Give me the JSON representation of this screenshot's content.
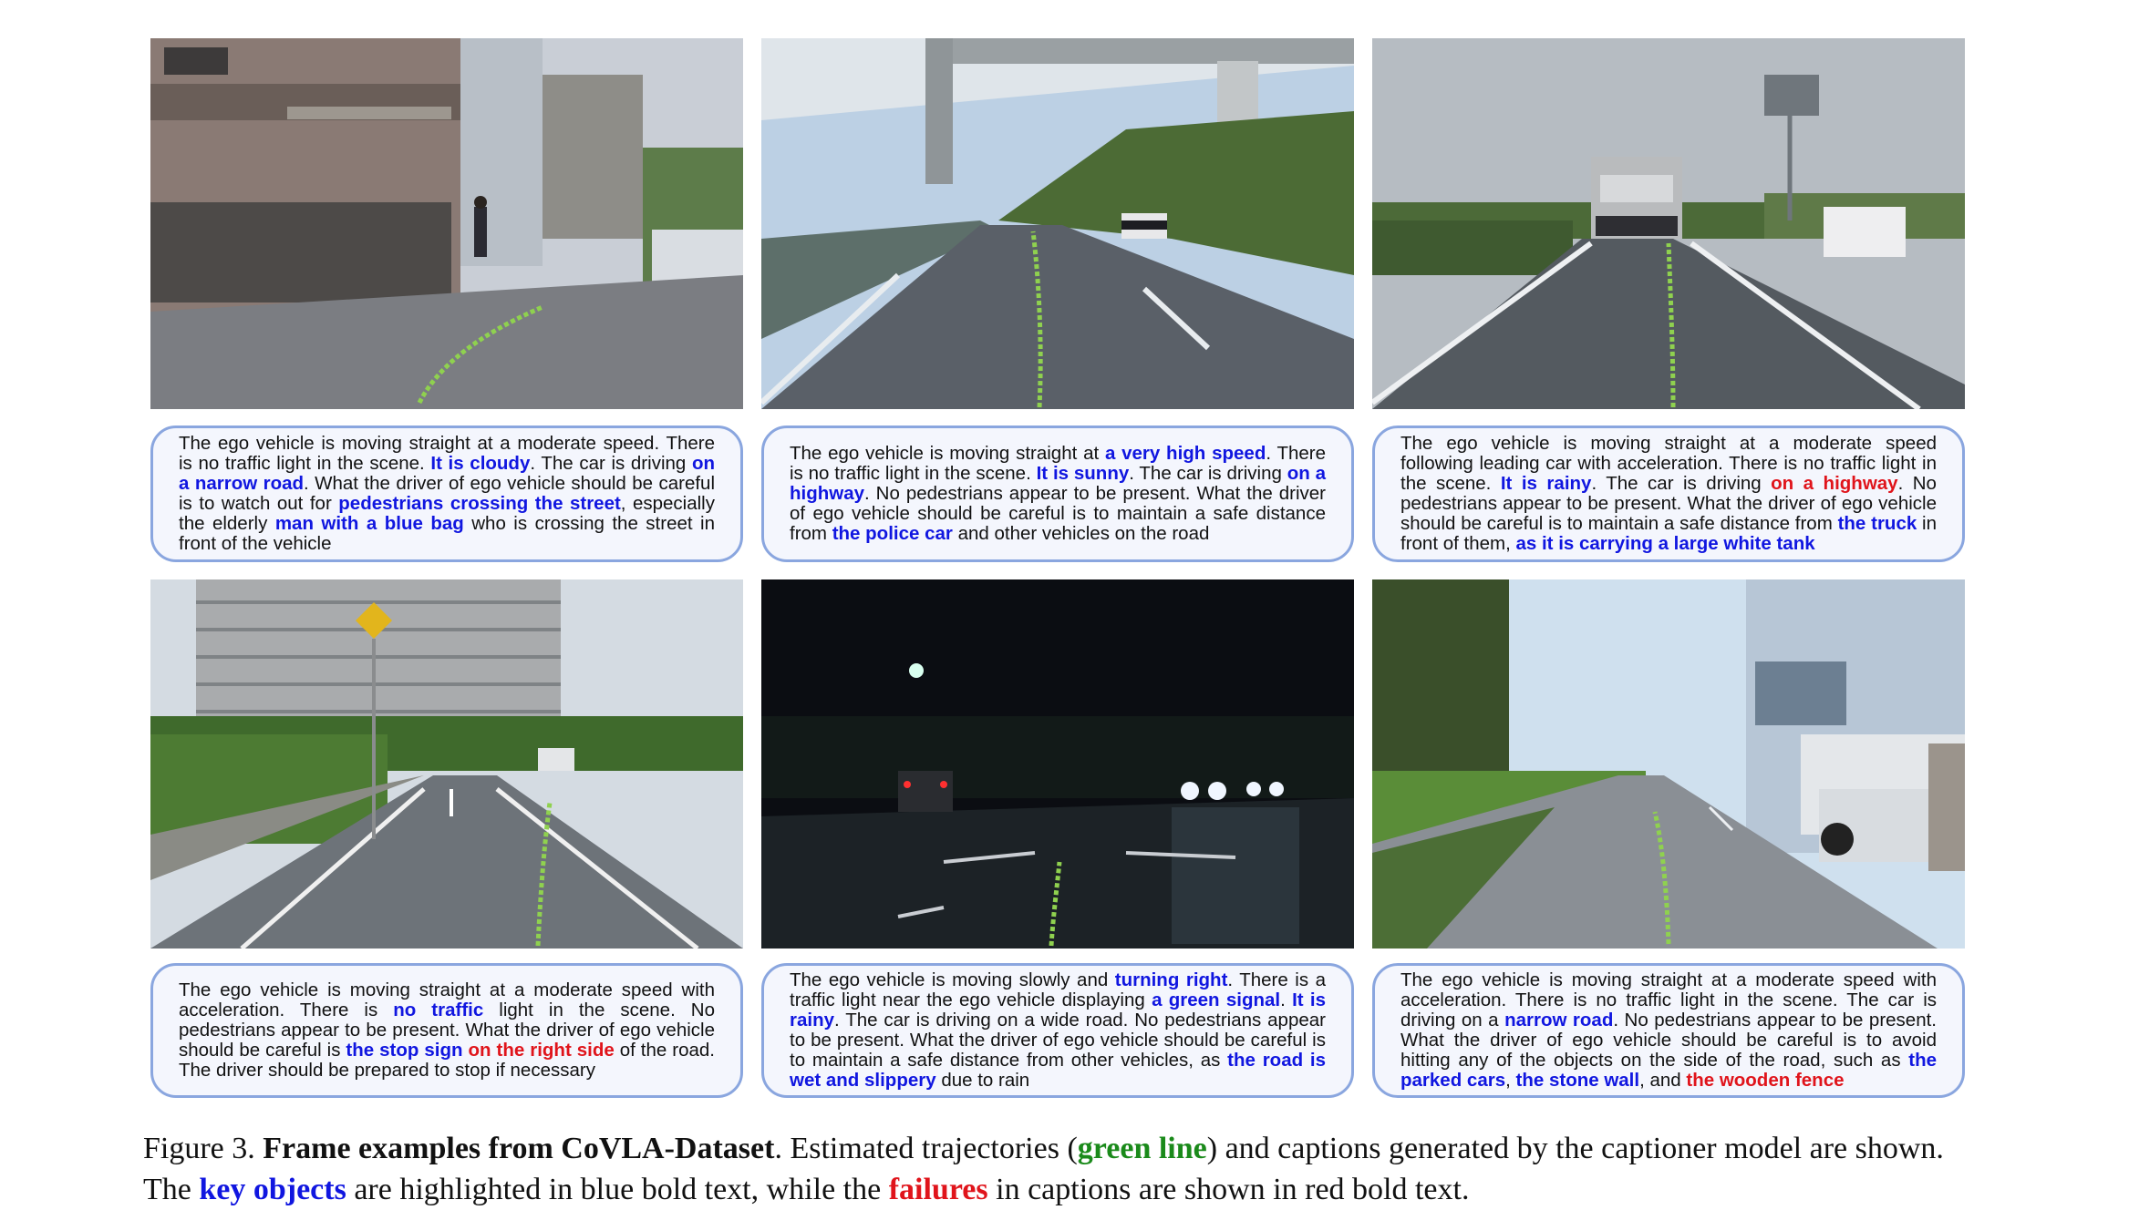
{
  "colors": {
    "key_object": "#1016e0",
    "failure": "#e0141b",
    "trajectory": "#8fd14f",
    "caption_border": "#8aa6df"
  },
  "frames": [
    {
      "scene": "narrow residential street with pedestrian",
      "caption_segments": [
        {
          "t": "The ego vehicle is moving straight at a moderate speed. There is no traffic light in the scene. ",
          "s": "n"
        },
        {
          "t": "It is cloudy",
          "s": "k"
        },
        {
          "t": ". The car is driving ",
          "s": "n"
        },
        {
          "t": "on a narrow road",
          "s": "k"
        },
        {
          "t": ". What the driver of ego vehicle should be careful is to watch out for ",
          "s": "n"
        },
        {
          "t": "pedestrians crossing the street",
          "s": "k"
        },
        {
          "t": ", especially the elderly ",
          "s": "n"
        },
        {
          "t": "man with a blue bag",
          "s": "k"
        },
        {
          "t": " who is crossing the street in front of the vehicle",
          "s": "n"
        }
      ]
    },
    {
      "scene": "highway under overpass with police car",
      "caption_segments": [
        {
          "t": "The ego vehicle is moving straight at ",
          "s": "n"
        },
        {
          "t": "a very high speed",
          "s": "k"
        },
        {
          "t": ". There is no traffic light in the scene. ",
          "s": "n"
        },
        {
          "t": "It is sunny",
          "s": "k"
        },
        {
          "t": ". The car is driving ",
          "s": "n"
        },
        {
          "t": "on a highway",
          "s": "k"
        },
        {
          "t": ". No pedestrians appear to be present. What the driver of ego vehicle should be careful is to maintain a safe distance from ",
          "s": "n"
        },
        {
          "t": "the police car",
          "s": "k"
        },
        {
          "t": " and other vehicles on the road",
          "s": "n"
        }
      ]
    },
    {
      "scene": "road following tanker truck",
      "caption_segments": [
        {
          "t": "The ego vehicle is moving straight at a moderate speed following leading car with acceleration. There is no traffic light in the scene. ",
          "s": "n"
        },
        {
          "t": "It is rainy",
          "s": "k"
        },
        {
          "t": ". The car is driving ",
          "s": "n"
        },
        {
          "t": "on a highway",
          "s": "f"
        },
        {
          "t": ". No pedestrians appear to be present. What the driver of ego vehicle should be careful is to maintain a safe distance from ",
          "s": "n"
        },
        {
          "t": "the truck",
          "s": "k"
        },
        {
          "t": " in front of them, ",
          "s": "n"
        },
        {
          "t": "as it is carrying a large white tank",
          "s": "k"
        }
      ]
    },
    {
      "scene": "wide road with stop sign and apartments",
      "caption_segments": [
        {
          "t": "The ego vehicle is moving straight at a moderate speed with acceleration. There is ",
          "s": "n"
        },
        {
          "t": "no traffic",
          "s": "k"
        },
        {
          "t": " light in the scene. No pedestrians appear to be present. What the driver of ego vehicle should be careful is ",
          "s": "n"
        },
        {
          "t": "the stop sign",
          "s": "k"
        },
        {
          "t": " ",
          "s": "n"
        },
        {
          "t": "on the right side",
          "s": "f"
        },
        {
          "t": " of the road. The driver should be prepared to stop if necessary",
          "s": "n"
        }
      ]
    },
    {
      "scene": "night intersection in rain",
      "caption_segments": [
        {
          "t": "The ego vehicle is moving slowly and ",
          "s": "n"
        },
        {
          "t": "turning right",
          "s": "k"
        },
        {
          "t": ". There is a traffic light near the ego vehicle displaying ",
          "s": "n"
        },
        {
          "t": "a green signal",
          "s": "k"
        },
        {
          "t": ". ",
          "s": "n"
        },
        {
          "t": "It is rainy",
          "s": "k"
        },
        {
          "t": ". The car is driving on a wide road. No pedestrians appear to be present. What the driver of ego vehicle should be careful is to maintain a safe distance from other vehicles, as ",
          "s": "n"
        },
        {
          "t": "the road is wet and slippery",
          "s": "k"
        },
        {
          "t": " due to rain",
          "s": "n"
        }
      ]
    },
    {
      "scene": "narrow rural road with parked car",
      "caption_segments": [
        {
          "t": "The ego vehicle is moving straight at a moderate speed with acceleration. There is no traffic light in the scene. The car is driving on a ",
          "s": "n"
        },
        {
          "t": "narrow road",
          "s": "k"
        },
        {
          "t": ". No pedestrians appear to be present. What the driver of ego vehicle should be careful is to avoid hitting any of the objects on the side of the road, such as ",
          "s": "n"
        },
        {
          "t": "the parked cars",
          "s": "k"
        },
        {
          "t": ", ",
          "s": "n"
        },
        {
          "t": "the stone wall",
          "s": "k"
        },
        {
          "t": ", and ",
          "s": "n"
        },
        {
          "t": "the wooden fence",
          "s": "f"
        }
      ]
    }
  ],
  "figure_caption": {
    "label": "Figure 3.",
    "title": "Frame examples from CoVLA-Dataset",
    "text1": ". Estimated trajectories (",
    "green": "green line",
    "text2": ") and captions generated by the captioner model are shown. The ",
    "blue": "key objects",
    "text3": " are highlighted in blue bold text, while the ",
    "red": "failures",
    "text4": " in captions are shown in red bold text."
  }
}
